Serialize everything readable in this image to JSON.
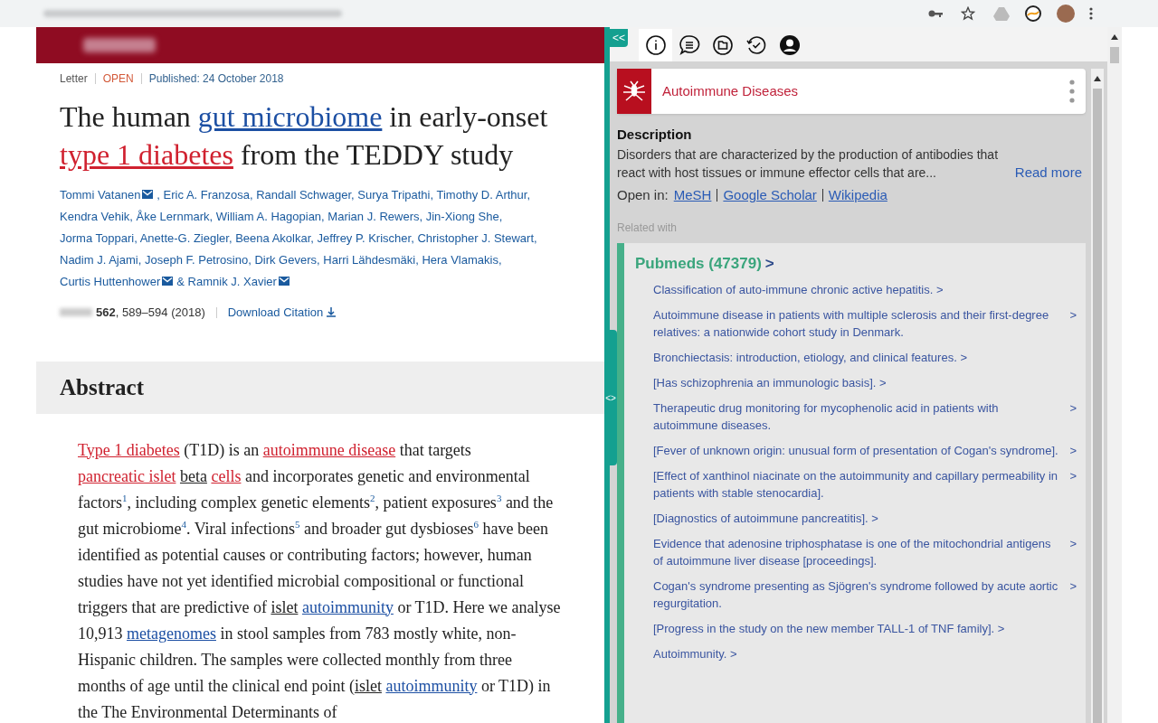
{
  "article": {
    "meta": [
      {
        "text": "Letter",
        "kind": "plain"
      },
      {
        "text": "OPEN",
        "kind": "open"
      },
      {
        "text": "Published: 24 October 2018",
        "kind": "date"
      }
    ],
    "title": [
      {
        "text": "The human ",
        "kind": "plain"
      },
      {
        "text": "gut microbiome",
        "kind": "blue"
      },
      {
        "text": " in early-onset ",
        "kind": "plain"
      },
      {
        "text": "type 1 diabetes",
        "kind": "red"
      },
      {
        "text": " from the TEDDY study",
        "kind": "plain"
      }
    ],
    "authors": [
      {
        "name": "Tommi Vatanen",
        "mail": true,
        "sep": ","
      },
      {
        "name": "Eric A. Franzosa",
        "mail": false,
        "sep": ","
      },
      {
        "name": "Randall Schwager",
        "mail": false,
        "sep": ","
      },
      {
        "name": "Surya Tripathi",
        "mail": false,
        "sep": ","
      },
      {
        "name": "Timothy D. Arthur",
        "mail": false,
        "sep": ","
      },
      {
        "name": "Kendra Vehik",
        "mail": false,
        "sep": ","
      },
      {
        "name": "Åke Lernmark",
        "mail": false,
        "sep": ","
      },
      {
        "name": "William A. Hagopian",
        "mail": false,
        "sep": ","
      },
      {
        "name": "Marian J. Rewers",
        "mail": false,
        "sep": ","
      },
      {
        "name": "Jin-Xiong She",
        "mail": false,
        "sep": ","
      },
      {
        "name": "Jorma Toppari",
        "mail": false,
        "sep": ","
      },
      {
        "name": "Anette-G. Ziegler",
        "mail": false,
        "sep": ","
      },
      {
        "name": "Beena Akolkar",
        "mail": false,
        "sep": ","
      },
      {
        "name": "Jeffrey P. Krischer",
        "mail": false,
        "sep": ","
      },
      {
        "name": "Christopher J. Stewart",
        "mail": false,
        "sep": ","
      },
      {
        "name": "Nadim J. Ajami",
        "mail": false,
        "sep": ","
      },
      {
        "name": "Joseph F. Petrosino",
        "mail": false,
        "sep": ","
      },
      {
        "name": "Dirk Gevers",
        "mail": false,
        "sep": ","
      },
      {
        "name": "Harri Lähdesmäki",
        "mail": false,
        "sep": ","
      },
      {
        "name": "Hera Vlamakis",
        "mail": false,
        "sep": ","
      },
      {
        "name": "Curtis Huttenhower",
        "mail": true,
        "sep": "&"
      },
      {
        "name": "Ramnik J. Xavier",
        "mail": true
      }
    ],
    "citation": "**562**, 589–594 (2018)",
    "download": "Download Citation",
    "abstract_heading": "Abstract",
    "abstract": [
      {
        "text": "Type 1 diabetes",
        "kind": "red"
      },
      {
        "text": " (T1D) is an ",
        "kind": "plain"
      },
      {
        "text": "autoimmune disease",
        "kind": "red"
      },
      {
        "text": " that targets ",
        "kind": "plain"
      },
      {
        "text": "pancreatic islet",
        "kind": "red"
      },
      {
        "text": "beta",
        "kind": "dark",
        "space_before": true
      },
      {
        "text": "cells",
        "kind": "red",
        "space_before": true
      },
      {
        "text": " and incorporates genetic and environmental factors",
        "kind": "plain"
      },
      {
        "text": "1",
        "kind": "ref"
      },
      {
        "text": ", including complex genetic elements",
        "kind": "plain"
      },
      {
        "text": "2",
        "kind": "ref"
      },
      {
        "text": ", patient exposures",
        "kind": "plain"
      },
      {
        "text": "3",
        "kind": "ref"
      },
      {
        "text": " and the gut microbiome",
        "kind": "plain"
      },
      {
        "text": "4",
        "kind": "ref"
      },
      {
        "text": ". Viral infections",
        "kind": "plain"
      },
      {
        "text": "5",
        "kind": "ref"
      },
      {
        "text": " and broader gut dysbioses",
        "kind": "plain"
      },
      {
        "text": "6",
        "kind": "ref"
      },
      {
        "text": " have been identified as potential causes or contributing factors; however, human studies have not yet identified microbial compositional or functional triggers that are predictive of ",
        "kind": "plain"
      },
      {
        "text": "islet",
        "kind": "dark"
      },
      {
        "text": "autoimmunity",
        "kind": "blue",
        "space_before": true
      },
      {
        "text": " or T1D. Here we analyse 10,913 ",
        "kind": "plain"
      },
      {
        "text": "metagenomes",
        "kind": "blue"
      },
      {
        "text": " in stool samples from 783 mostly white, non-Hispanic children. The samples were collected monthly from three months of age until the clinical end point (",
        "kind": "plain"
      },
      {
        "text": "islet",
        "kind": "dark"
      },
      {
        "text": "autoimmunity",
        "kind": "blue",
        "space_before": true
      },
      {
        "text": " or T1D) in the The Environmental Determinants of",
        "kind": "plain"
      }
    ]
  },
  "panel": {
    "collapse": "<<",
    "handle": "<>",
    "tabs": [
      {
        "kind": "info",
        "selected": true
      },
      {
        "kind": "chat",
        "selected": false
      },
      {
        "kind": "folder",
        "selected": false
      },
      {
        "kind": "history",
        "selected": false
      },
      {
        "kind": "user",
        "selected": false
      }
    ],
    "topic": "Autoimmune Diseases",
    "description_label": "Description",
    "description": "Disorders that are characterized by the production of antibodies that react with host tissues or immune effector cells that are...",
    "read_more": "Read more",
    "open_in_label": "Open in:",
    "open_in": [
      "MeSH",
      "Google Scholar",
      "Wikipedia"
    ],
    "related_label": "Related with",
    "pubmeds": "Pubmeds (47379)",
    "pubmeds_arrow": ">",
    "items": [
      {
        "text": "Classification of auto-immune chronic active hepatitis.",
        "arrow": ">",
        "inline": true
      },
      {
        "text": "Autoimmune disease in patients with multiple sclerosis and their first-degree relatives: a nationwide cohort study in Denmark.",
        "arrow": ">",
        "inline": false
      },
      {
        "text": "Bronchiectasis: introduction, etiology, and clinical features.",
        "arrow": ">",
        "inline": true
      },
      {
        "text": "[Has schizophrenia an immunologic basis].",
        "arrow": ">",
        "inline": true
      },
      {
        "text": "Therapeutic drug monitoring for mycophenolic acid in patients with autoimmune diseases.",
        "arrow": ">",
        "inline": false
      },
      {
        "text": "[Fever of unknown origin: unusual form of presentation of Cogan's syndrome].",
        "arrow": ">",
        "inline": false
      },
      {
        "text": "[Effect of xanthinol niacinate on the autoimmunity and capillary permeability in patients with stable stenocardia].",
        "arrow": ">",
        "inline": false
      },
      {
        "text": "[Diagnostics of autoimmune pancreatitis].",
        "arrow": ">",
        "inline": true
      },
      {
        "text": "Evidence that adenosine triphosphatase is one of the mitochondrial antigens of autoimmune liver disease [proceedings].",
        "arrow": ">",
        "inline": false
      },
      {
        "text": "Cogan's syndrome presenting as Sjögren's syndrome followed by acute aortic regurgitation.",
        "arrow": ">",
        "inline": false
      },
      {
        "text": "[Progress in the study on the new member TALL-1 of TNF family].",
        "arrow": ">",
        "inline": true
      },
      {
        "text": "Autoimmunity.",
        "arrow": ">",
        "inline": true
      }
    ]
  }
}
